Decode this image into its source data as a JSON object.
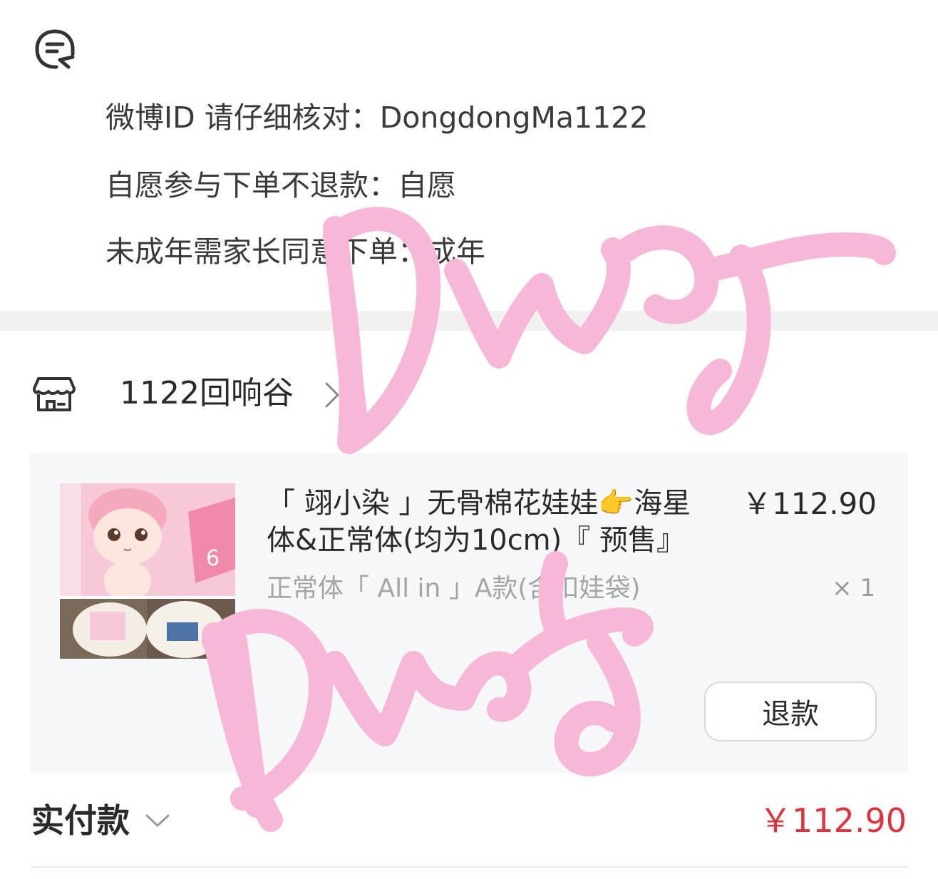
{
  "info": {
    "weibo_id": "微博ID 请仔细核对：DongdongMa1122",
    "no_refund": "自愿参与下单不退款：自愿",
    "minor": "未成年需家长同意下单：成年"
  },
  "shop": {
    "name": "1122回响谷"
  },
  "product": {
    "title": "「 翊小染 」无骨棉花娃娃👉海星体&正常体(均为10cm)『 预售』",
    "price": "￥112.90",
    "variant": "正常体「 All in 」A款(含扣娃袋)",
    "quantity": "× 1",
    "refund_label": "退款"
  },
  "payment": {
    "label": "实付款",
    "amount": "￥112.90"
  },
  "colors": {
    "accent_red": "#e0323c",
    "scribble_pink": "#f6b8d6",
    "card_bg": "#f6f7f9"
  },
  "icons": [
    "note-icon",
    "shop-icon",
    "chevron-right-icon",
    "chevron-down-icon"
  ]
}
